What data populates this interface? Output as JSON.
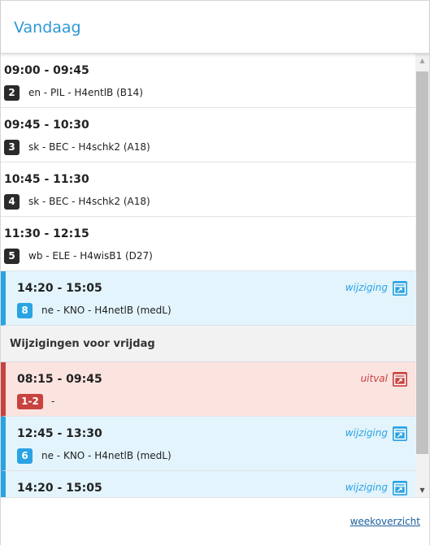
{
  "header": {
    "title": "Vandaag"
  },
  "today": [
    {
      "time": "09:00 - 09:45",
      "hour": "2",
      "desc": "en - PIL - H4entlB (B14)"
    },
    {
      "time": "09:45 - 10:30",
      "hour": "3",
      "desc": "sk - BEC - H4schk2 (A18)"
    },
    {
      "time": "10:45 - 11:30",
      "hour": "4",
      "desc": "sk - BEC - H4schk2 (A18)"
    },
    {
      "time": "11:30 - 12:15",
      "hour": "5",
      "desc": "wb - ELE - H4wisB1 (D27)"
    },
    {
      "time": "14:20 - 15:05",
      "hour": "8",
      "desc": "ne - KNO - H4netlB (medL)",
      "status": "wijziging"
    }
  ],
  "section": {
    "label": "Wijzigingen voor vrijdag"
  },
  "friday": [
    {
      "time": "08:15 - 09:45",
      "hour": "1-2",
      "desc": "-",
      "status": "uitval"
    },
    {
      "time": "12:45 - 13:30",
      "hour": "6",
      "desc": "ne - KNO - H4netlB (medL)",
      "status": "wijziging"
    },
    {
      "time": "14:20 - 15:05",
      "status": "wijziging"
    }
  ],
  "footer": {
    "link": "weekoverzicht"
  },
  "colors": {
    "accent": "#2e97d4",
    "changed": "#2aa3e3",
    "cancelled": "#c8423f"
  },
  "icons": {
    "changed": "calendar-swap-icon",
    "cancelled": "calendar-cancel-icon"
  }
}
